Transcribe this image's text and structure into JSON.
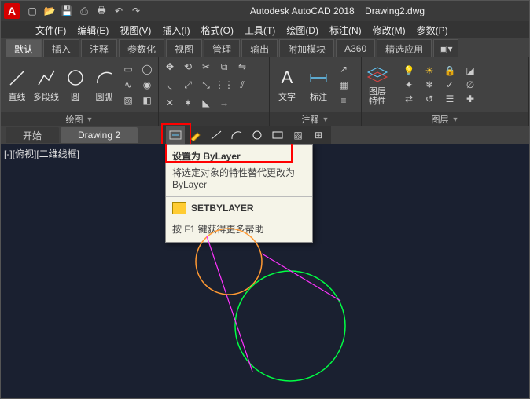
{
  "title": {
    "app": "Autodesk AutoCAD 2018",
    "file": "Drawing2.dwg"
  },
  "menubar": [
    "文件(F)",
    "编辑(E)",
    "视图(V)",
    "插入(I)",
    "格式(O)",
    "工具(T)",
    "绘图(D)",
    "标注(N)",
    "修改(M)",
    "参数(P)"
  ],
  "ribbon_tabs": [
    "默认",
    "插入",
    "注释",
    "参数化",
    "视图",
    "管理",
    "输出",
    "附加模块",
    "A360",
    "精选应用"
  ],
  "draw_panel": {
    "title": "绘图",
    "btns": [
      "直线",
      "多段线",
      "圆",
      "圆弧"
    ]
  },
  "annot_panel": {
    "title": "注释",
    "btns": [
      "文字",
      "标注"
    ]
  },
  "layer_panel": {
    "title": "图层",
    "btn": "图层\n特性"
  },
  "file_tabs": [
    "开始",
    "Drawing 2"
  ],
  "viewport_label": "[-][俯视][二维线框]",
  "tooltip": {
    "title": "设置为 ByLayer",
    "desc": "将选定对象的特性替代更改为 ByLayer",
    "cmd": "SETBYLAYER",
    "help": "按 F1 键获得更多帮助"
  }
}
